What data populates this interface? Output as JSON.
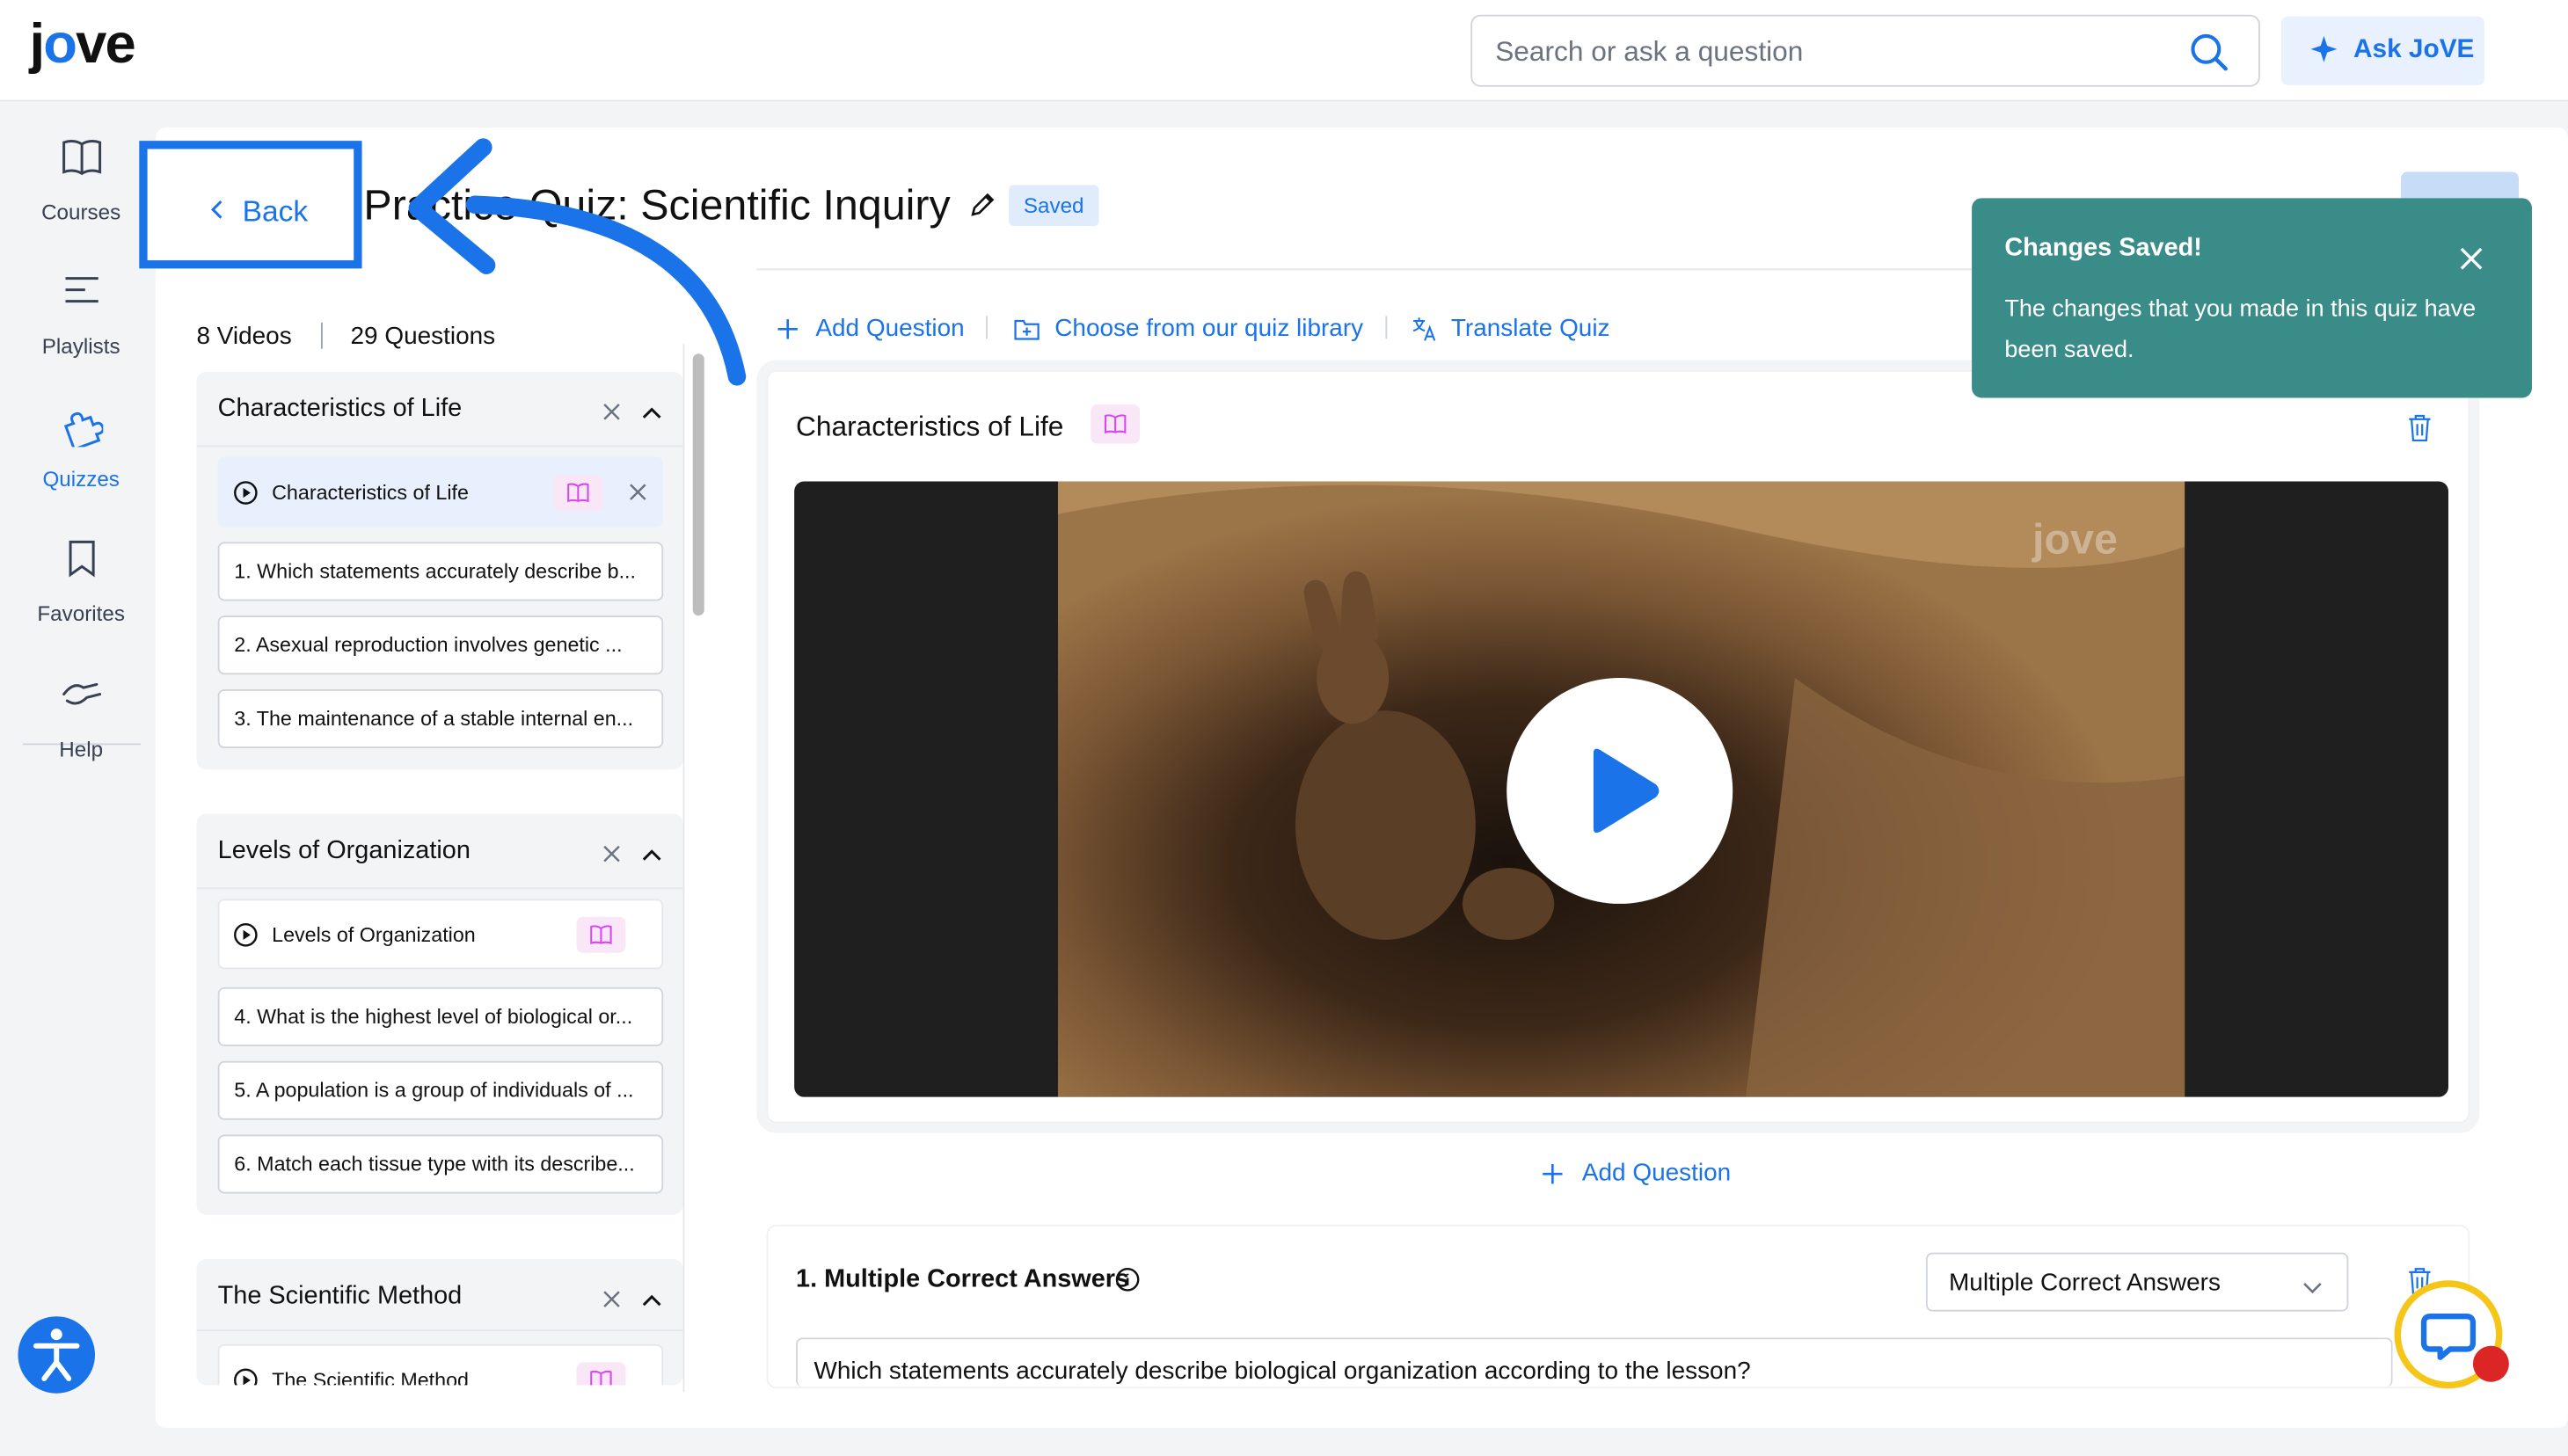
{
  "header": {
    "logo": "jove",
    "search_placeholder": "Search or ask a question",
    "ask_label": "Ask JoVE"
  },
  "sidebar": {
    "items": [
      {
        "label": "Courses",
        "icon": "book-icon"
      },
      {
        "label": "Playlists",
        "icon": "playlist-icon"
      },
      {
        "label": "Quizzes",
        "icon": "puzzle-icon",
        "active": true
      },
      {
        "label": "Favorites",
        "icon": "bookmark-icon"
      },
      {
        "label": "Help",
        "icon": "help-icon"
      }
    ]
  },
  "quiz": {
    "back_label": "Back",
    "title": "Practice Quiz: Scientific Inquiry",
    "saved_badge": "Saved",
    "videos_count": "8 Videos",
    "questions_count": "29 Questions"
  },
  "outline": {
    "groups": [
      {
        "title": "Characteristics of Life",
        "video": "Characteristics of Life",
        "questions": [
          "1. Which statements accurately describe b...",
          "2. Asexual reproduction involves genetic ...",
          "3. The maintenance of a stable internal en..."
        ]
      },
      {
        "title": "Levels of Organization",
        "video": "Levels of Organization",
        "questions": [
          "4. What is the highest level of biological or...",
          "5. A population is a group of individuals of ...",
          "6. Match each tissue type with its describe..."
        ]
      },
      {
        "title": "The Scientific Method",
        "video": "The Scientific Method",
        "questions": []
      }
    ]
  },
  "toolbar": {
    "add_question": "Add Question",
    "choose_library": "Choose from our quiz library",
    "translate": "Translate Quiz"
  },
  "main": {
    "section_title": "Characteristics of Life",
    "video_watermark": "jove",
    "add_question": "Add Question",
    "question": {
      "title": "1. Multiple Correct Answers",
      "type_selected": "Multiple Correct Answers",
      "text": "Which statements accurately describe biological organization according to the lesson?"
    }
  },
  "toast": {
    "title": "Changes Saved!",
    "body": "The changes that you made in this quiz have been saved."
  },
  "colors": {
    "accent": "#1a73e8",
    "toast_bg": "#3a8c89",
    "book_badge_bg": "#f9e6f7",
    "chat_ring": "#f5c518",
    "notification_dot": "#dc2626"
  }
}
